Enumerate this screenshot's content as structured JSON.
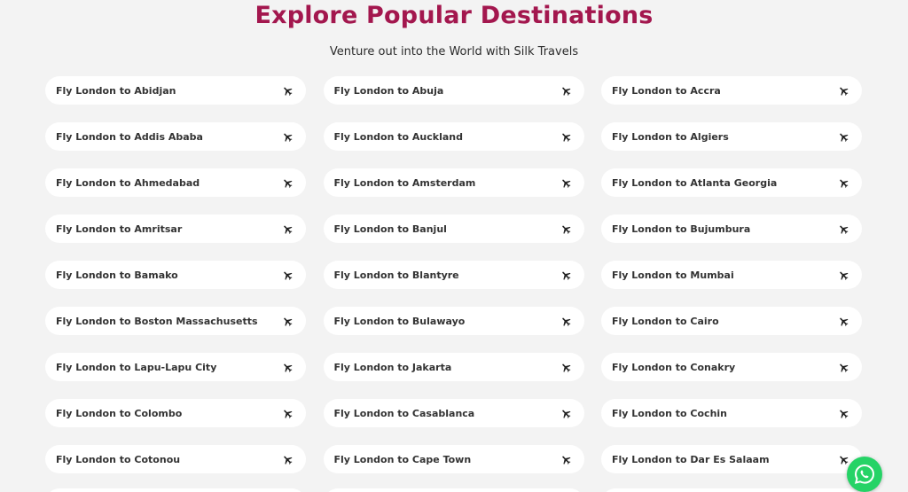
{
  "header": {
    "title": "Explore Popular Destinations",
    "subtitle": "Venture out into the World with Silk Travels"
  },
  "colors": {
    "title": "#a3174e",
    "card_background": "#ffffff",
    "page_background": "#f3f3f3",
    "whatsapp": "#25d366"
  },
  "destinations": [
    {
      "label": "Fly London to Abidjan",
      "icon": "plane-icon"
    },
    {
      "label": "Fly London to Abuja",
      "icon": "plane-icon"
    },
    {
      "label": "Fly London to Accra",
      "icon": "plane-icon"
    },
    {
      "label": "Fly London to Addis Ababa",
      "icon": "plane-icon"
    },
    {
      "label": "Fly London to Auckland",
      "icon": "plane-icon"
    },
    {
      "label": "Fly London to Algiers",
      "icon": "plane-icon"
    },
    {
      "label": "Fly London to Ahmedabad",
      "icon": "plane-icon"
    },
    {
      "label": "Fly London to Amsterdam",
      "icon": "plane-icon"
    },
    {
      "label": "Fly London to Atlanta Georgia",
      "icon": "plane-icon"
    },
    {
      "label": "Fly London to Amritsar",
      "icon": "plane-icon"
    },
    {
      "label": "Fly London to Banjul",
      "icon": "plane-icon"
    },
    {
      "label": "Fly London to Bujumbura",
      "icon": "plane-icon"
    },
    {
      "label": "Fly London to Bamako",
      "icon": "plane-icon"
    },
    {
      "label": "Fly London to Blantyre",
      "icon": "plane-icon"
    },
    {
      "label": "Fly London to Mumbai",
      "icon": "plane-icon"
    },
    {
      "label": "Fly London to Boston Massachusetts",
      "icon": "plane-icon"
    },
    {
      "label": "Fly London to Bulawayo",
      "icon": "plane-icon"
    },
    {
      "label": "Fly London to Cairo",
      "icon": "plane-icon"
    },
    {
      "label": "Fly London to Lapu-Lapu City",
      "icon": "plane-icon"
    },
    {
      "label": "Fly London to Jakarta",
      "icon": "plane-icon"
    },
    {
      "label": "Fly London to Conakry",
      "icon": "plane-icon"
    },
    {
      "label": "Fly London to Colombo",
      "icon": "plane-icon"
    },
    {
      "label": "Fly London to Casablanca",
      "icon": "plane-icon"
    },
    {
      "label": "Fly London to Cochin",
      "icon": "plane-icon"
    },
    {
      "label": "Fly London to Cotonou",
      "icon": "plane-icon"
    },
    {
      "label": "Fly London to Cape Town",
      "icon": "plane-icon"
    },
    {
      "label": "Fly London to Dar Es Salaam",
      "icon": "plane-icon"
    }
  ],
  "floating": {
    "whatsapp_icon": "whatsapp-icon"
  }
}
